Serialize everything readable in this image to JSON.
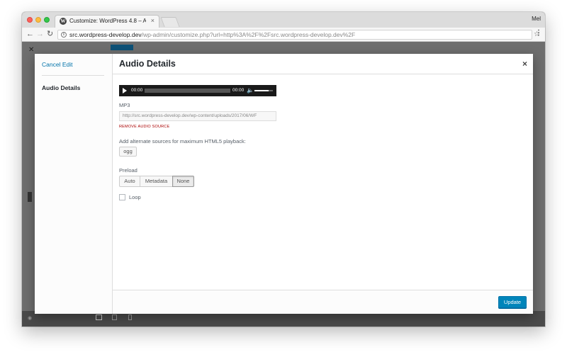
{
  "browser": {
    "tab_title": "Customize: WordPress 4.8 – A",
    "tab_favicon": "W",
    "tab_close": "×",
    "profile_name": "Mel",
    "url_host": "src.wordpress-develop.dev",
    "url_path": "/wp-admin/customize.php?url=http%3A%2F%2Fsrc.wordpress-develop.dev%2F",
    "icons": [
      "back-arrow-icon",
      "forward-arrow-icon",
      "reload-icon",
      "info-icon",
      "star-icon",
      "menu-icon"
    ]
  },
  "modal": {
    "title": "Audio Details",
    "close_glyph": "×",
    "menu": {
      "cancel_label": "Cancel Edit",
      "active_item": "Audio Details"
    },
    "player": {
      "current_time": "00:00",
      "duration": "00:00"
    },
    "source": {
      "label": "MP3",
      "value": "http://src.wordpress-develop.dev/wp-content/uploads/2017/06/WF",
      "remove_label": "REMOVE AUDIO SOURCE"
    },
    "alt_sources": {
      "label": "Add alternate sources for maximum HTML5 playback:",
      "buttons": [
        "ogg"
      ]
    },
    "preload": {
      "label": "Preload",
      "options": [
        "Auto",
        "Metadata",
        "None"
      ],
      "selected": "None"
    },
    "loop": {
      "label": "Loop",
      "checked": false
    },
    "footer": {
      "update_label": "Update"
    }
  },
  "colors": {
    "link": "#0073aa",
    "primary_button": "#0085ba",
    "remove_link": "#aa0000"
  }
}
